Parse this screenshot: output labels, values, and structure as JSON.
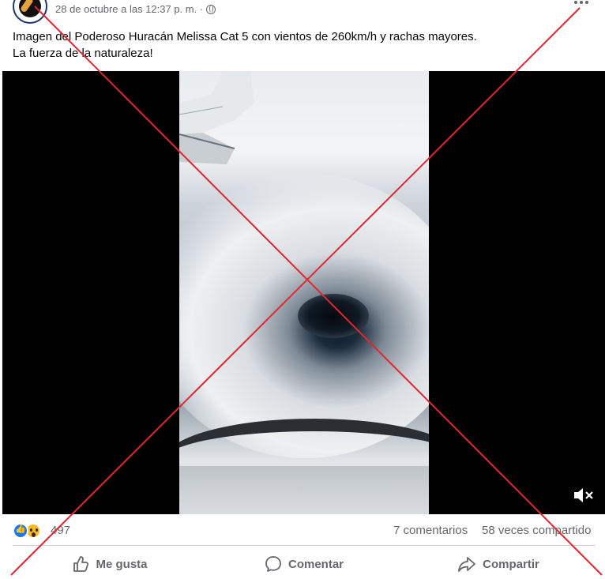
{
  "post": {
    "timestamp": "28 de octubre a las 12:37 p. m. ·",
    "caption_line1": "Imagen del Poderoso Huracán Melissa Cat 5 con vientos de 260km/h y rachas mayores.",
    "caption_line2": "La fuerza de la naturaleza!"
  },
  "video": {
    "muted": true,
    "icon": "volume-muted-icon"
  },
  "stats": {
    "reactions": [
      "like-reaction-icon",
      "wow-reaction-icon"
    ],
    "reaction_count": "497",
    "comments": "7 comentarios",
    "shares": "58 veces compartido"
  },
  "actions": {
    "like_label": "Me gusta",
    "comment_label": "Comentar",
    "share_label": "Compartir"
  },
  "overlay": {
    "type": "red-x",
    "color": "#e32630"
  }
}
